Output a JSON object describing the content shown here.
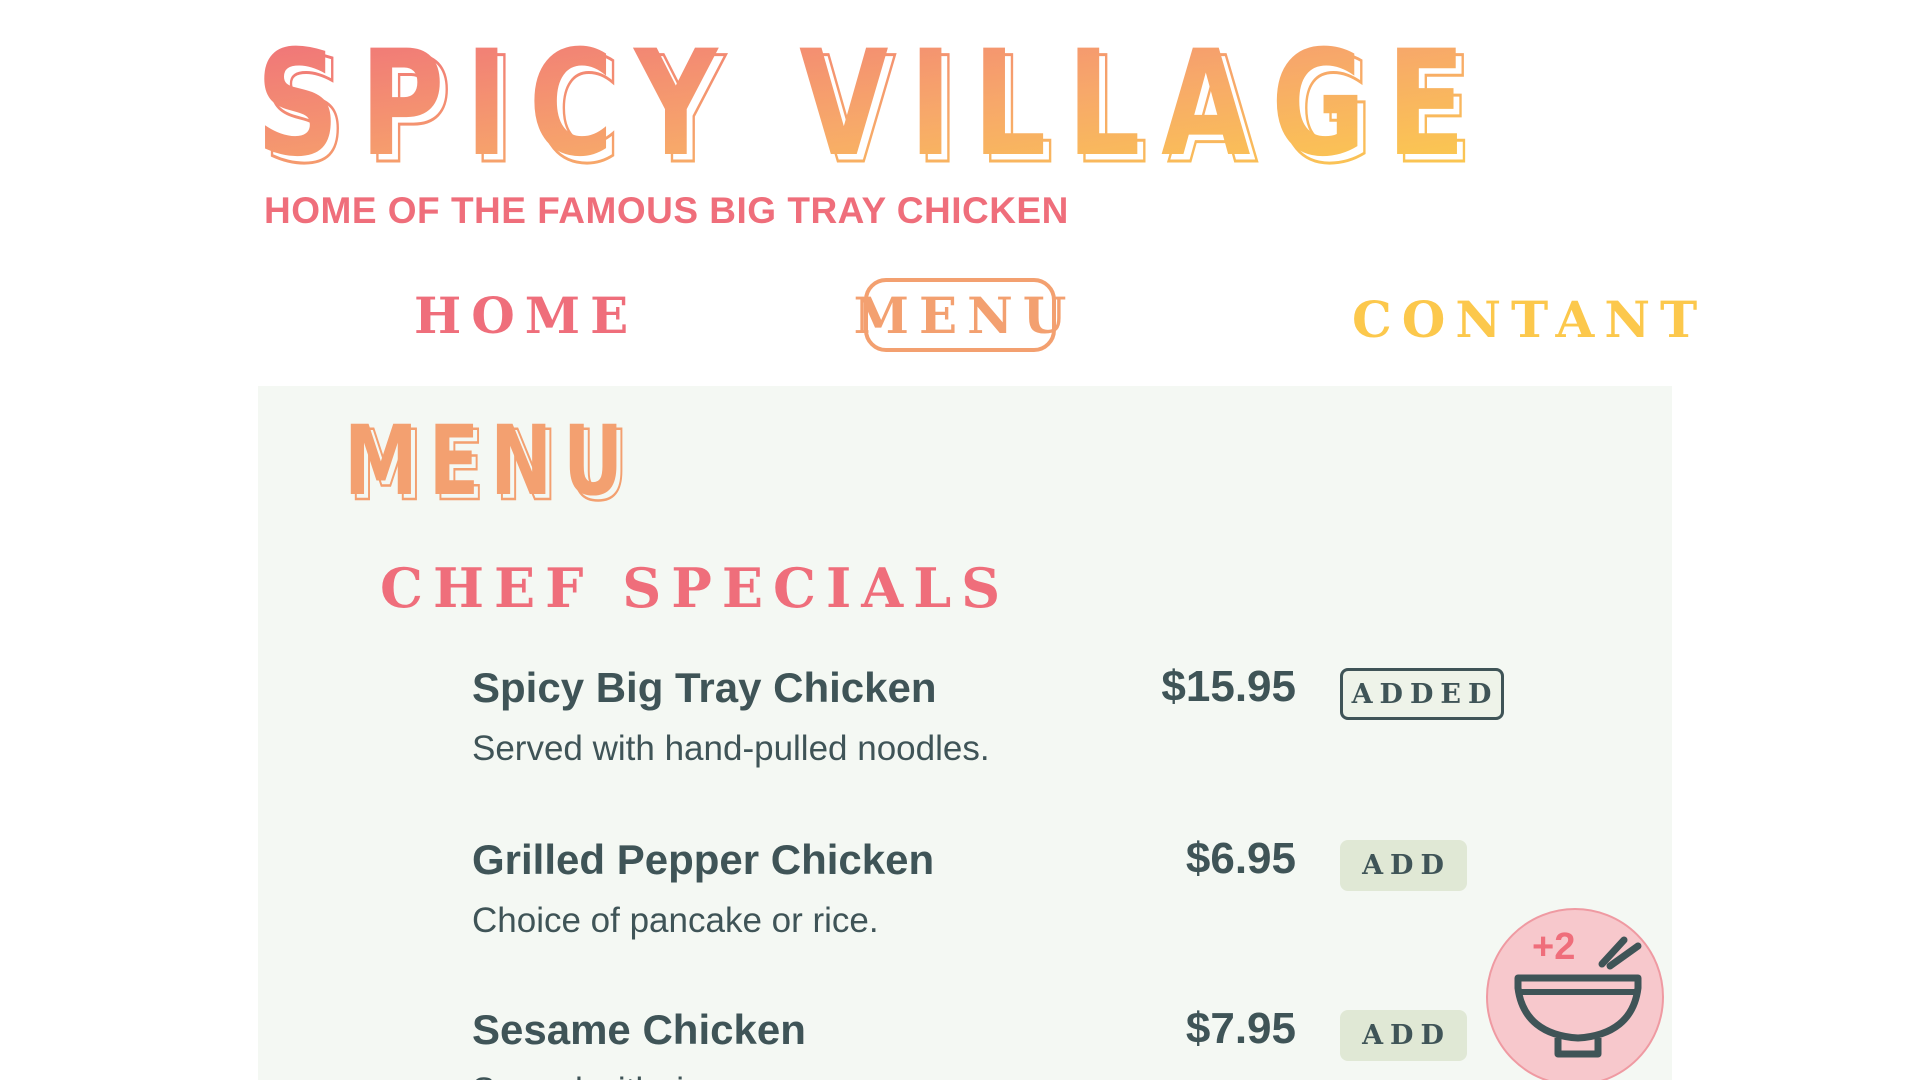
{
  "header": {
    "site_title": "SPICY VILLAGE",
    "tagline": "HOME OF THE FAMOUS BIG TRAY CHICKEN"
  },
  "nav": {
    "home": "HOME",
    "menu": "MENU",
    "contact": "CONTANT"
  },
  "main": {
    "heading": "MENU",
    "section": "CHEF SPECIALS",
    "items": [
      {
        "name": "Spicy Big Tray Chicken",
        "description": "Served with hand-pulled noodles.",
        "price": "$15.95",
        "button": "ADDED"
      },
      {
        "name": "Grilled Pepper Chicken",
        "description": "Choice of pancake or rice.",
        "price": "$6.95",
        "button": "ADD"
      },
      {
        "name": "Sesame Chicken",
        "description": "Served with rice.",
        "price": "$7.95",
        "button": "ADD"
      }
    ]
  },
  "cart": {
    "count": "+2",
    "icon": "bowl-with-chopsticks-icon"
  },
  "colors": {
    "coral": "#ef6e7b",
    "orange": "#f3a070",
    "yellow": "#fcc84c",
    "ink": "#3f5457",
    "panel": "#f4f8f3"
  }
}
